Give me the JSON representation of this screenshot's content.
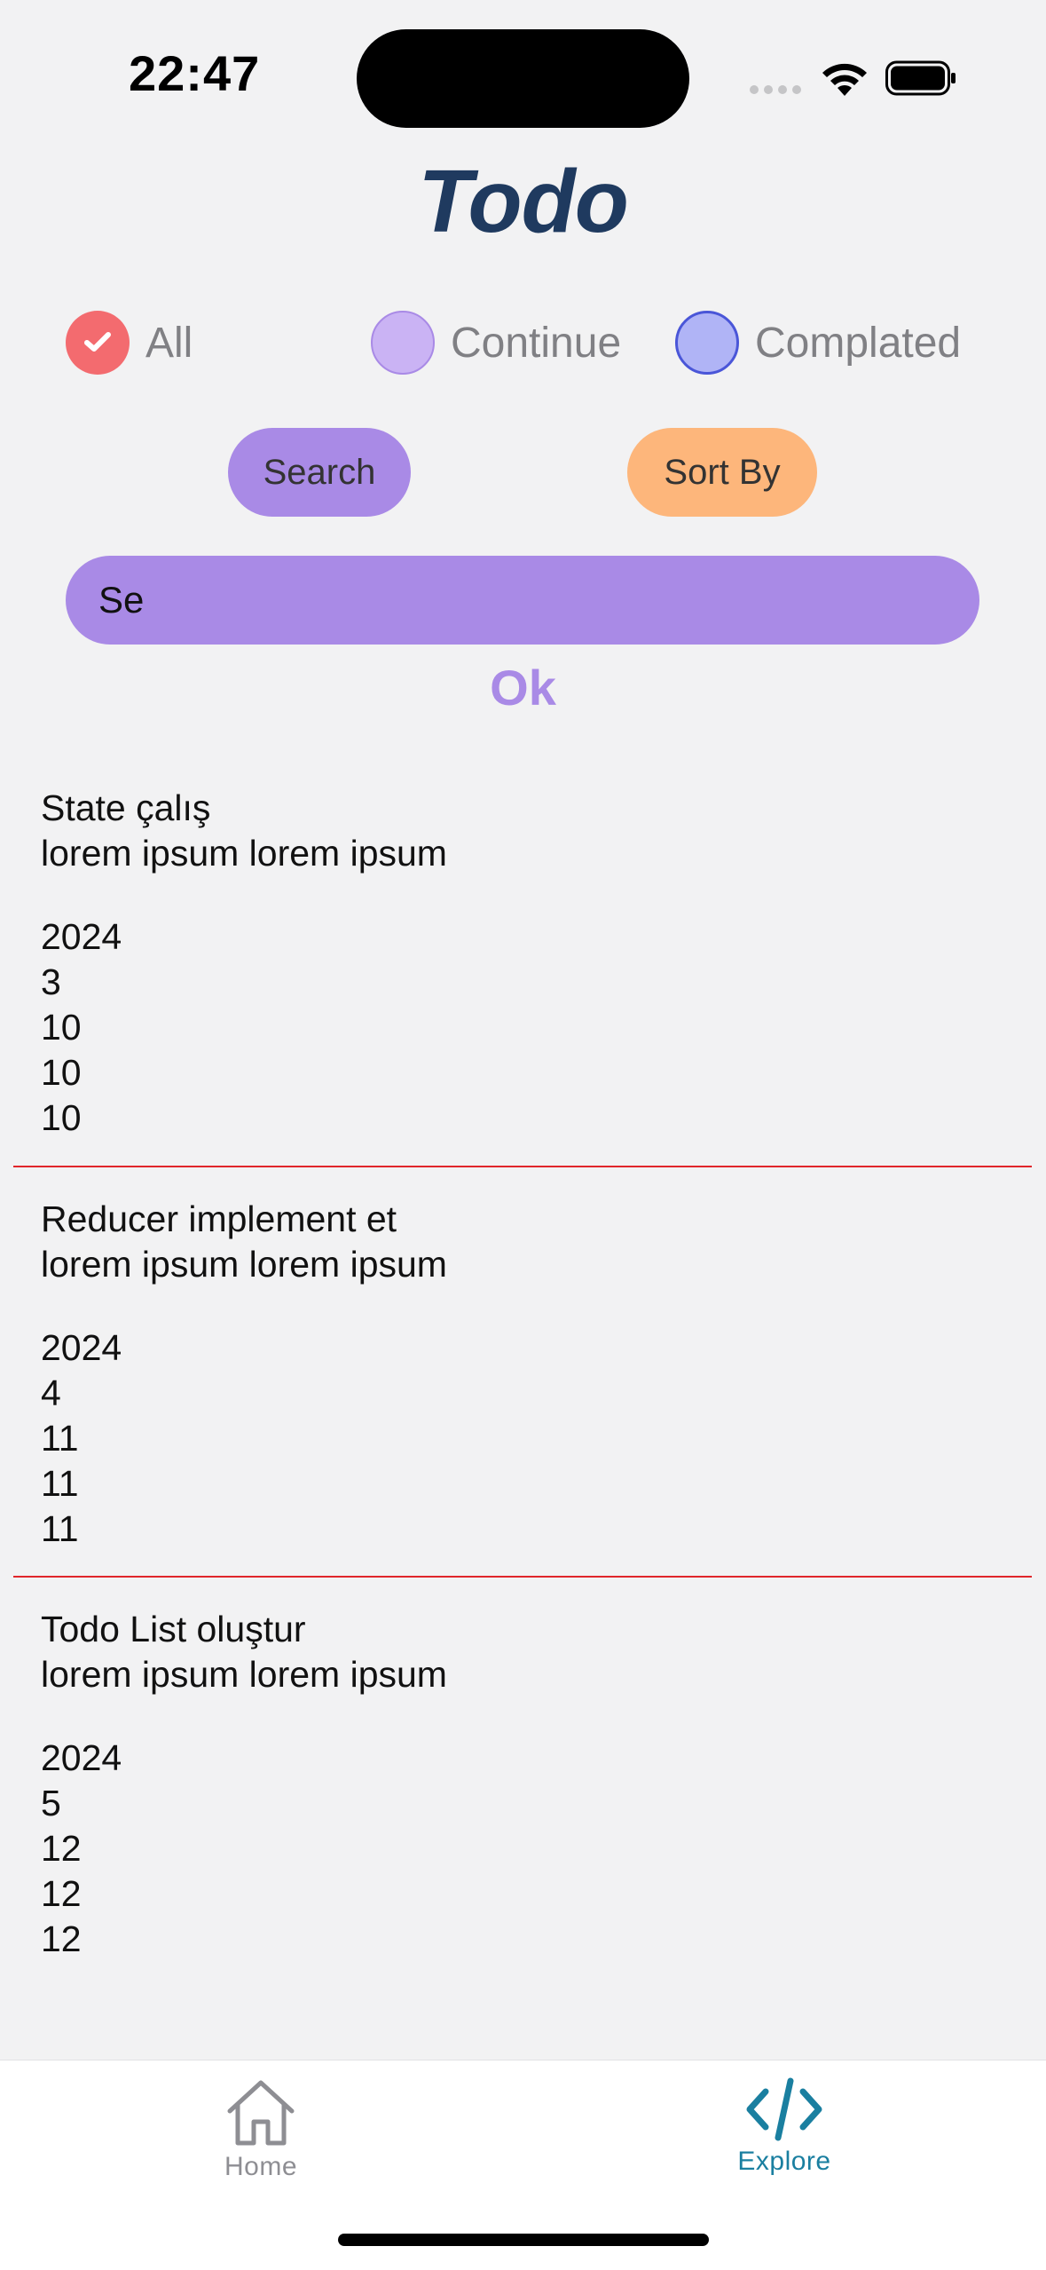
{
  "status_bar": {
    "time": "22:47"
  },
  "header": {
    "title": "Todo"
  },
  "filters": [
    {
      "label": "All",
      "selected": true,
      "color": "#f36b6f"
    },
    {
      "label": "Continue",
      "selected": false,
      "color": "#cab3f4"
    },
    {
      "label": "Complated",
      "selected": false,
      "color": "#b0b4f6"
    }
  ],
  "actions": {
    "search_label": "Search",
    "sort_label": "Sort By"
  },
  "search": {
    "value": "Se",
    "ok_label": "Ok"
  },
  "todos": [
    {
      "title": "State çalış",
      "description": "lorem ipsum lorem ipsum",
      "year": "2024",
      "month": "3",
      "day": "10",
      "hour": "10",
      "minute": "10"
    },
    {
      "title": "Reducer implement et",
      "description": "lorem ipsum lorem ipsum",
      "year": "2024",
      "month": "4",
      "day": "11",
      "hour": "11",
      "minute": "11"
    },
    {
      "title": "Todo List oluştur",
      "description": "lorem ipsum lorem ipsum",
      "year": "2024",
      "month": "5",
      "day": "12",
      "hour": "12",
      "minute": "12"
    }
  ],
  "tabbar": {
    "items": [
      {
        "label": "Home",
        "icon": "house-icon",
        "active": false
      },
      {
        "label": "Explore",
        "icon": "code-icon",
        "active": true
      }
    ]
  },
  "colors": {
    "accent": "#a98ae6",
    "title": "#1f3a5f",
    "sort": "#fdb67b",
    "divider": "#e0262a",
    "active_tab": "#1a7fa0"
  }
}
